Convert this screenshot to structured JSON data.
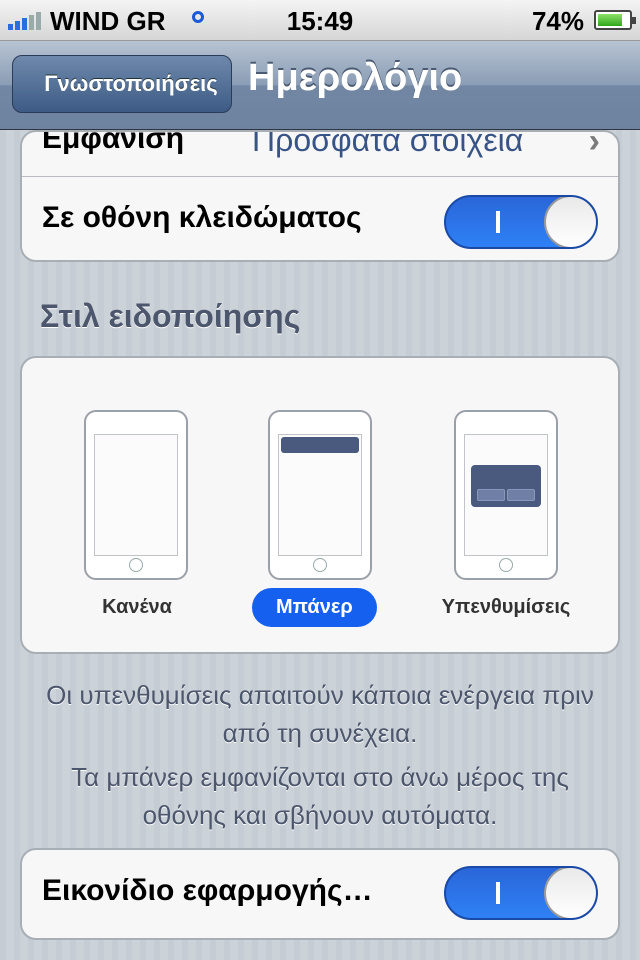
{
  "status_bar": {
    "carrier": "WIND GR",
    "time": "15:49",
    "battery_percent": "74%",
    "battery_level": 0.74
  },
  "nav": {
    "back_label": "Γνωστοποιήσεις",
    "title": "Ημερολόγιο"
  },
  "settings_top": {
    "view_label": "Εμφάνιση",
    "view_value": "Πρόσφατα στοιχεία",
    "lock_screen_label": "Σε οθόνη κλειδώματος",
    "lock_screen_on": true
  },
  "alert_style": {
    "header": "Στιλ ειδοποίησης",
    "options": [
      "Κανένα",
      "Μπάνερ",
      "Υπενθυμίσεις"
    ],
    "selected": "Μπάνερ"
  },
  "notes": {
    "line1": "Οι υπενθυμίσεις απαιτούν κάποια ενέργεια πριν από τη συνέχεια.",
    "line2": "Τα μπάνερ εμφανίζονται στο άνω μέρος της οθόνης και σβήνουν αυτόματα."
  },
  "badge": {
    "label": "Εικονίδιο εφαρμογής…",
    "on": true
  },
  "colors": {
    "accent": "#1660f0",
    "nav_bar": "#6e83a0",
    "background": "#c5ccd4"
  }
}
